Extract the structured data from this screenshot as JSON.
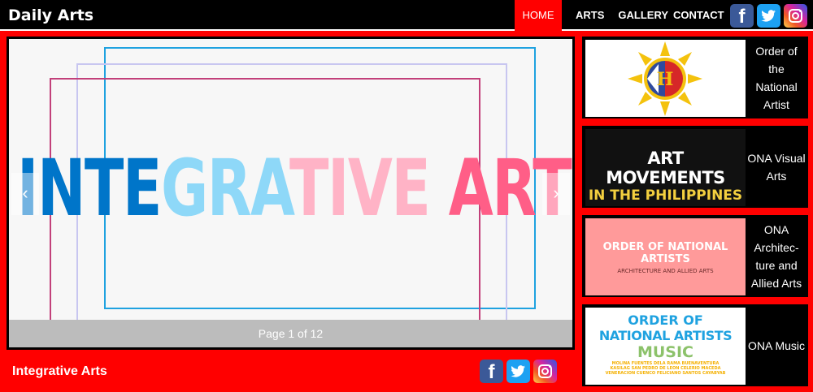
{
  "header": {
    "brand": "Daily Arts",
    "nav": [
      {
        "label": "HOME",
        "active": true
      },
      {
        "label": "ARTS"
      },
      {
        "label": "GALLERY"
      },
      {
        "label": "CONTACT"
      }
    ],
    "social": {
      "facebook": "f",
      "twitter": "twitter-icon",
      "instagram": "instagram-icon"
    }
  },
  "slider": {
    "headline_parts": [
      "INTE",
      "GRA",
      "TIVE",
      " ART"
    ],
    "pager": "Page 1 of 12",
    "prev_arrow": "‹",
    "next_arrow": "›"
  },
  "footer_caption": "Integrative Arts",
  "cards": [
    {
      "label": "Order of the National Artist"
    },
    {
      "label": "ONA Visual Arts",
      "thumb_lines": [
        "ART MOVEMENTS",
        "IN THE PHILIPPINES"
      ]
    },
    {
      "label": "ONA Architec- ture and Allied Arts",
      "thumb_lines": [
        "ORDER OF NATIONAL",
        "ARTISTS",
        "ARCHITECTURE AND ALLIED ARTS"
      ]
    },
    {
      "label": "ONA Music",
      "thumb_lines": [
        "ORDER OF",
        "NATIONAL ARTISTS",
        "MUSIC",
        "MOLINA FUENTES DELA RAMA BUENAVENTURA",
        "KASILAG SAN PEDRO DE LEON CELERIO MACEDA",
        "VENERACION CUENCO FELICIANO SANTOS CAYABYAB"
      ]
    }
  ],
  "colors": {
    "primary": "#ff0000",
    "bar": "#000000",
    "headline": [
      "#0075c9",
      "#8ed8f8",
      "#c9c8f0",
      "#ff6b8c"
    ]
  }
}
